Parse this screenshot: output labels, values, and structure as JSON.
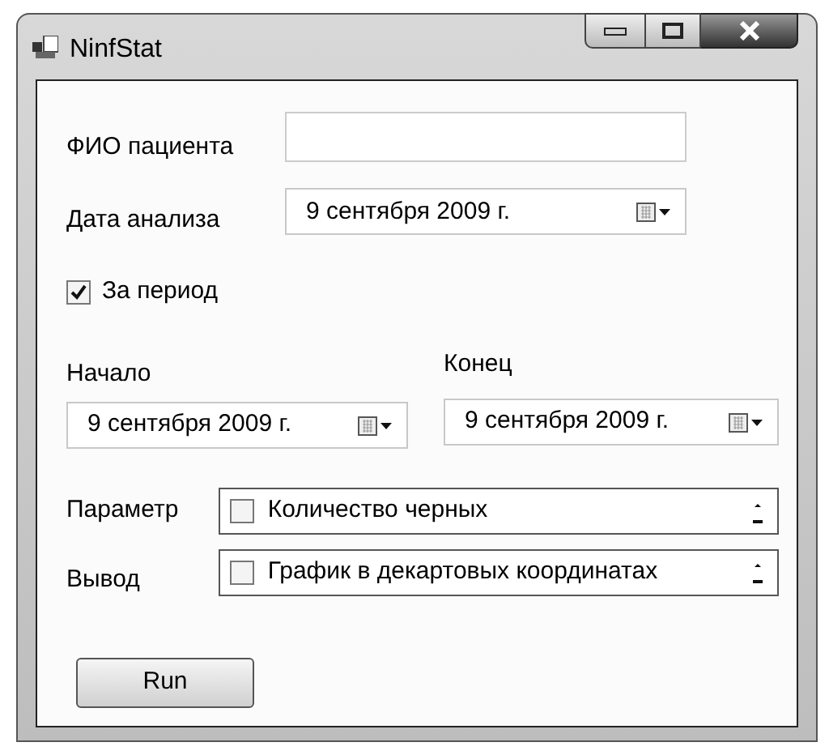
{
  "window": {
    "title": "NinfStat"
  },
  "patient": {
    "label": "ФИО пациента"
  },
  "analysis_date": {
    "label": "Дата анализа",
    "value": "9 сентября 2009 г."
  },
  "period": {
    "label": "За период",
    "checked": true
  },
  "start": {
    "label": "Начало",
    "value": "9 сентября 2009 г."
  },
  "end": {
    "label": "Конец",
    "value": "9 сентября 2009 г."
  },
  "lists": [
    {
      "label": "Параметр",
      "item": "Количество черных",
      "checked": false
    },
    {
      "label": "Вывод",
      "item": "График в декартовых координатах",
      "checked": false
    }
  ],
  "run_button": "Run"
}
